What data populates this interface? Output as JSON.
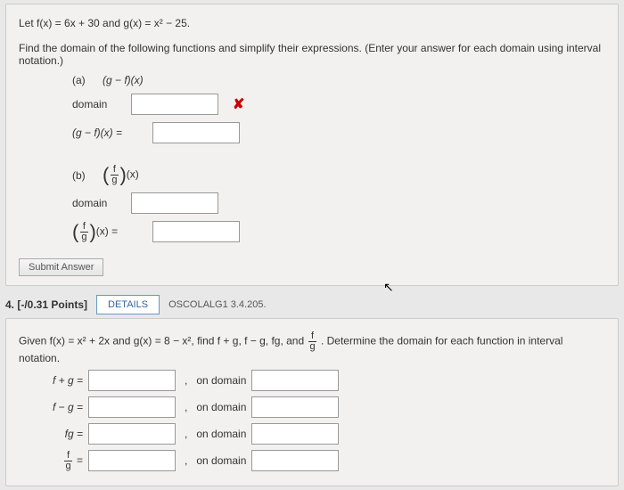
{
  "q3": {
    "let_stmt": "Let  f(x) = 6x + 30  and  g(x) = x² − 25.",
    "instruct": "Find the domain of the following functions and simplify their expressions. (Enter your answer for each domain using interval notation.)",
    "part_a_label": "(a)",
    "part_a_fn": "(g − f)(x)",
    "domain_label": "domain",
    "gf_eq_label": "(g − f)(x) =",
    "part_b_label": "(b)",
    "part_b_fn_text": "(x)",
    "fg_frac_eq_text": "(x) =",
    "submit_label": "Submit Answer",
    "wrong_mark": "✘"
  },
  "q4": {
    "header_pts": "4. [-/0.31 Points]",
    "details_label": "DETAILS",
    "ref": "OSCOLALG1 3.4.205.",
    "given": "Given  f(x) = x² + 2x  and  g(x) = 8 − x²,  find  f + g, f − g, fg,  and ",
    "given_tail": ".  Determine the domain for each function in interval notation.",
    "rows": [
      {
        "label": "f + g =",
        "dom_label": "on domain"
      },
      {
        "label": "f − g =",
        "dom_label": "on domain"
      },
      {
        "label": "fg =",
        "dom_label": "on domain"
      },
      {
        "label_frac": true,
        "dom_label": "on domain"
      }
    ],
    "frac_num": "f",
    "frac_den": "g",
    "frac_eq": " ="
  }
}
